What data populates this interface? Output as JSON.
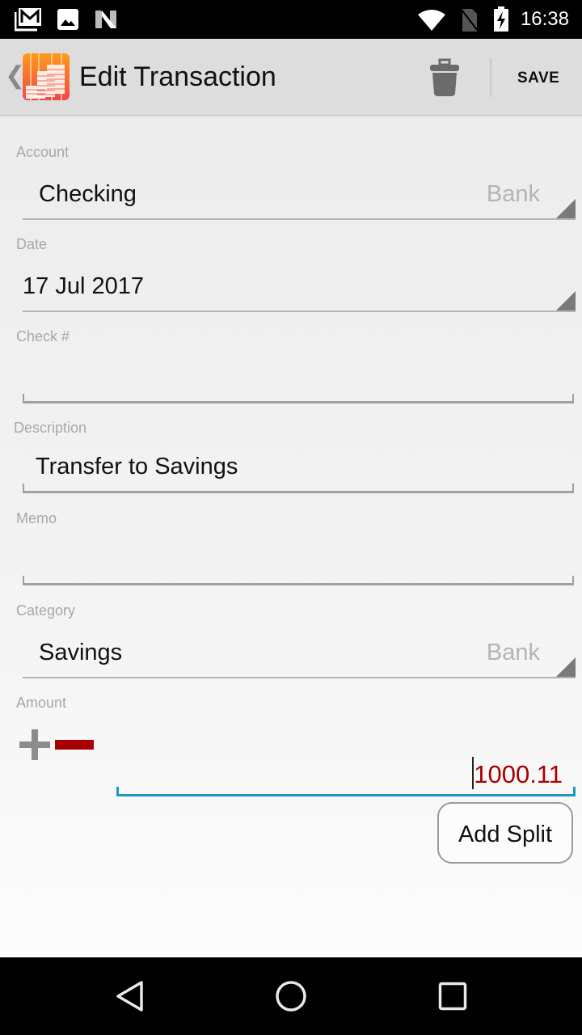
{
  "status_bar": {
    "time": "16:38",
    "left_icons": [
      "gmail-icon",
      "image-icon",
      "n-notification-icon"
    ],
    "right_icons": [
      "wifi-icon",
      "no-sim-icon",
      "battery-charging-icon"
    ]
  },
  "app_bar": {
    "title": "Edit Transaction",
    "delete_icon": "trash-icon",
    "save_label": "SAVE"
  },
  "form": {
    "account": {
      "label": "Account",
      "value": "Checking",
      "type": "Bank"
    },
    "date": {
      "label": "Date",
      "value": "17 Jul 2017"
    },
    "check": {
      "label": "Check #",
      "value": ""
    },
    "description": {
      "label": "Description",
      "value": "Transfer to Savings"
    },
    "memo": {
      "label": "Memo",
      "value": ""
    },
    "category": {
      "label": "Category",
      "value": "Savings",
      "type": "Bank"
    },
    "amount": {
      "label": "Amount",
      "value": "1000.11",
      "sign": "negative"
    }
  },
  "buttons": {
    "add_split": "Add Split"
  },
  "colors": {
    "accent": "#1e9ac0",
    "negative_amount": "#a80000"
  },
  "nav_bar": {
    "icons": [
      "back-icon",
      "home-icon",
      "recents-icon"
    ]
  }
}
